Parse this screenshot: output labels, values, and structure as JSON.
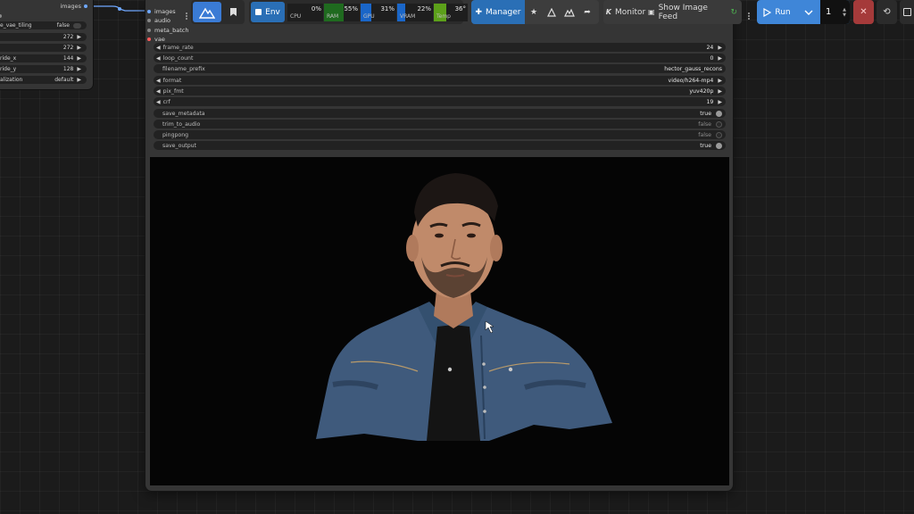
{
  "left_node": {
    "output_label": "images",
    "widgets": [
      {
        "label": "e_vae_tiling",
        "value": "false"
      },
      {
        "label": "",
        "value": "272"
      },
      {
        "label": "",
        "value": "272"
      },
      {
        "label": "ride_x",
        "value": "144"
      },
      {
        "label": "ride_y",
        "value": "128"
      },
      {
        "label": "alization",
        "value": "default"
      }
    ]
  },
  "node": {
    "inputs": [
      "images",
      "audio",
      "meta_batch",
      "vae"
    ],
    "widgets": [
      {
        "label": "frame_rate",
        "value": "24"
      },
      {
        "label": "loop_count",
        "value": "0"
      },
      {
        "label": "filename_prefix",
        "value": "hector_gauss_recons"
      },
      {
        "label": "format",
        "value": "video/h264-mp4"
      },
      {
        "label": "pix_fmt",
        "value": "yuv420p"
      },
      {
        "label": "crf",
        "value": "19"
      },
      {
        "label": "save_metadata",
        "value": "true"
      },
      {
        "label": "trim_to_audio",
        "value": "false"
      },
      {
        "label": "pingpong",
        "value": "false"
      },
      {
        "label": "save_output",
        "value": "true"
      }
    ]
  },
  "toolbar": {
    "env_label": "Env",
    "meters": [
      {
        "name": "CPU",
        "percent": "0%",
        "fill": 0,
        "color": "#1f6a1f"
      },
      {
        "name": "RAM",
        "percent": "55%",
        "fill": 0.55,
        "color": "#1f6a1f"
      },
      {
        "name": "GPU",
        "percent": "31%",
        "fill": 0.31,
        "color": "#1a66c8"
      },
      {
        "name": "VRAM",
        "percent": "22%",
        "fill": 0.22,
        "color": "#1a66c8"
      },
      {
        "name": "Temp",
        "percent": "36°",
        "fill": 0.36,
        "color": "#5ca01a"
      }
    ],
    "manager_label": "Manager",
    "monitor_label": "Monitor",
    "show_feed_label": "Show Image Feed",
    "run_label": "Run",
    "batch_count": "1"
  },
  "colors": {
    "accent": "#2a6fb6",
    "run": "#3f86d8",
    "stop": "#a53a3a"
  }
}
